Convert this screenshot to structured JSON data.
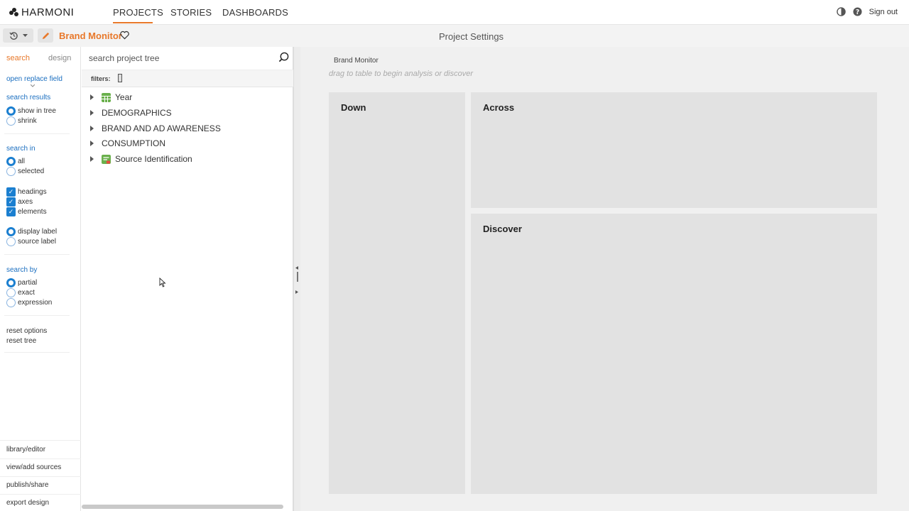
{
  "brand": {
    "logo_text": "HARMONI"
  },
  "nav": {
    "tabs": [
      {
        "label": "PROJECTS",
        "active": true
      },
      {
        "label": "STORIES",
        "active": false
      },
      {
        "label": "DASHBOARDS",
        "active": false
      }
    ],
    "sign_out": "Sign out",
    "accent_color": "#e8782a"
  },
  "subbar": {
    "project_name": "Brand Monitor",
    "page_title": "Project Settings",
    "history_icon": "history-icon",
    "edit_icon": "pencil-icon",
    "favorite_icon": "heart-icon"
  },
  "left_options": {
    "tabs": [
      {
        "label": "search",
        "active": true
      },
      {
        "label": "design",
        "active": false
      }
    ],
    "open_replace_field": "open replace field",
    "search_results": {
      "heading": "search results",
      "options": [
        {
          "label": "show in tree",
          "selected": true
        },
        {
          "label": "shrink",
          "selected": false
        }
      ]
    },
    "search_in": {
      "heading": "search in",
      "options": [
        {
          "label": "all",
          "selected": true
        },
        {
          "label": "selected",
          "selected": false
        }
      ],
      "checks": [
        {
          "label": "headings",
          "checked": true
        },
        {
          "label": "axes",
          "checked": true
        },
        {
          "label": "elements",
          "checked": true
        }
      ],
      "label_options": [
        {
          "label": "display label",
          "selected": true
        },
        {
          "label": "source label",
          "selected": false
        }
      ]
    },
    "search_by": {
      "heading": "search by",
      "options": [
        {
          "label": "partial",
          "selected": true
        },
        {
          "label": "exact",
          "selected": false
        },
        {
          "label": "expression",
          "selected": false
        }
      ]
    },
    "reset_options": "reset options",
    "reset_tree": "reset tree",
    "bottom_links": [
      "library/editor",
      "view/add sources",
      "publish/share",
      "export design"
    ]
  },
  "tree": {
    "search_placeholder": "search project tree",
    "filters_label": "filters:",
    "items": [
      {
        "label": "Year",
        "icon": "table-icon"
      },
      {
        "label": "DEMOGRAPHICS",
        "icon": ""
      },
      {
        "label": "BRAND AND AD AWARENESS",
        "icon": ""
      },
      {
        "label": "CONSUMPTION",
        "icon": ""
      },
      {
        "label": "Source Identification",
        "icon": "source-icon"
      }
    ]
  },
  "workarea": {
    "title": "Brand Monitor",
    "hint": "drag to table to begin analysis or discover",
    "panels": {
      "down": "Down",
      "across": "Across",
      "discover": "Discover"
    }
  }
}
